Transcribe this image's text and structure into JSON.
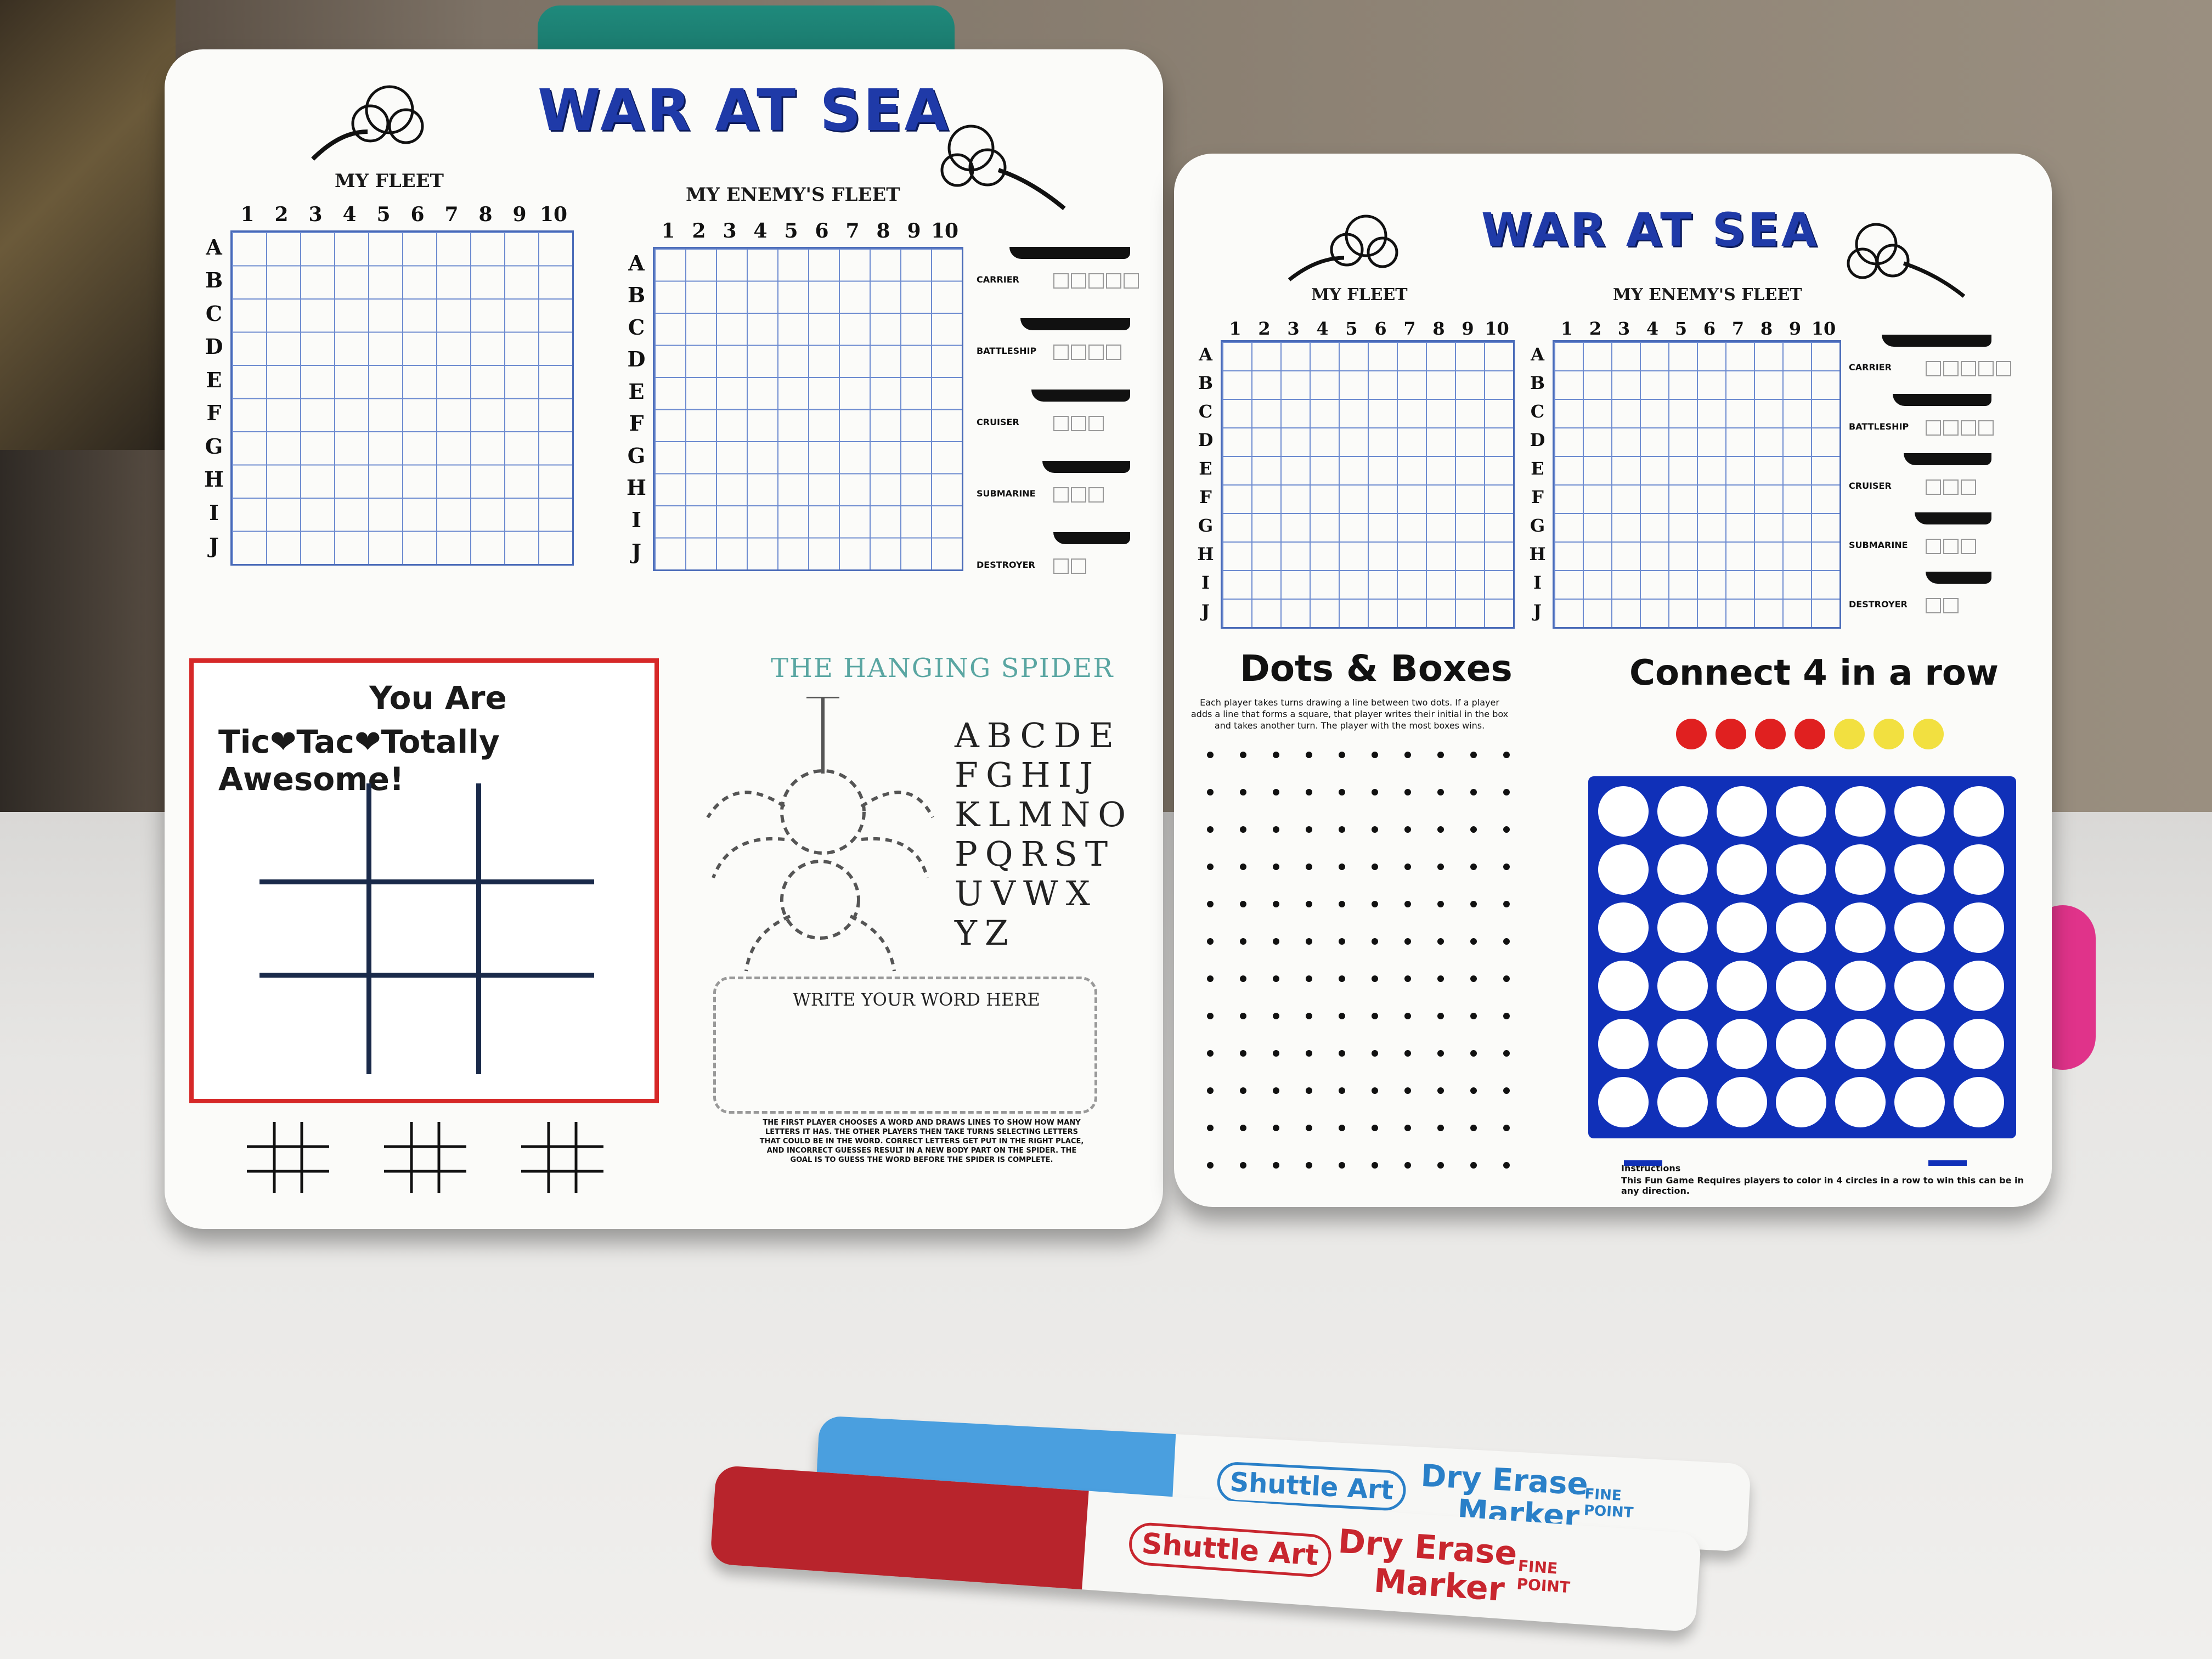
{
  "scene": {
    "board_left": {
      "title": "WAR AT SEA",
      "my_fleet_label": "MY FLEET",
      "enemy_fleet_label": "MY ENEMY'S FLEET",
      "column_numbers": [
        "1",
        "2",
        "3",
        "4",
        "5",
        "6",
        "7",
        "8",
        "9",
        "10"
      ],
      "row_letters": [
        "A",
        "B",
        "C",
        "D",
        "E",
        "F",
        "G",
        "H",
        "I",
        "J"
      ],
      "ships": [
        {
          "name": "CARRIER",
          "boxes": 5
        },
        {
          "name": "BATTLESHIP",
          "boxes": 4
        },
        {
          "name": "CRUISER",
          "boxes": 3
        },
        {
          "name": "SUBMARINE",
          "boxes": 3
        },
        {
          "name": "DESTROYER",
          "boxes": 2
        }
      ],
      "ttt_line1": "You Are",
      "ttt_line2": "Tic❤Tac❤Totally Awesome!",
      "spider_title": "THE HANGING SPIDER",
      "alphabet_rows": [
        "ABCDE",
        "FGHIJ",
        "KLMNO",
        "PQRST",
        "UVWX",
        "YZ"
      ],
      "word_box_label": "WRITE YOUR WORD HERE",
      "spider_instructions": "THE FIRST PLAYER CHOOSES A WORD AND DRAWS LINES TO SHOW HOW MANY LETTERS IT HAS. THE OTHER PLAYERS THEN TAKE TURNS SELECTING LETTERS THAT COULD BE IN THE WORD. CORRECT LETTERS GET PUT IN THE RIGHT PLACE, AND INCORRECT GUESSES RESULT IN A NEW BODY PART ON THE SPIDER. THE GOAL IS TO GUESS THE WORD BEFORE THE SPIDER IS COMPLETE."
    },
    "board_right": {
      "title": "WAR AT SEA",
      "my_fleet_label": "MY FLEET",
      "enemy_fleet_label": "MY ENEMY'S FLEET",
      "dots_title": "Dots & Boxes",
      "dots_instructions": "Each player takes turns drawing a line between two dots. If a player adds a line that forms a square, that player writes their initial in the box and takes another turn. The player with the most boxes wins.",
      "connect_title": "Connect 4 in a row",
      "connect_instr_heading": "Instructions",
      "connect_instr": "This Fun Game Requires players to color in 4 circles in a row to win this can be in any direction.",
      "chip_colors": [
        "#e02020",
        "#e02020",
        "#e02020",
        "#e02020",
        "#f2e040",
        "#f2e040",
        "#f2e040"
      ]
    },
    "markers": [
      {
        "brand": "Shuttle Art",
        "line1": "Dry Erase",
        "line2": "Marker",
        "tip": "FINE POINT",
        "color": "#3a9bd9"
      },
      {
        "brand": "Shuttle Art",
        "line1": "Dry Erase",
        "line2": "Marker",
        "tip": "FINE POINT",
        "color": "#c8262e"
      }
    ]
  }
}
